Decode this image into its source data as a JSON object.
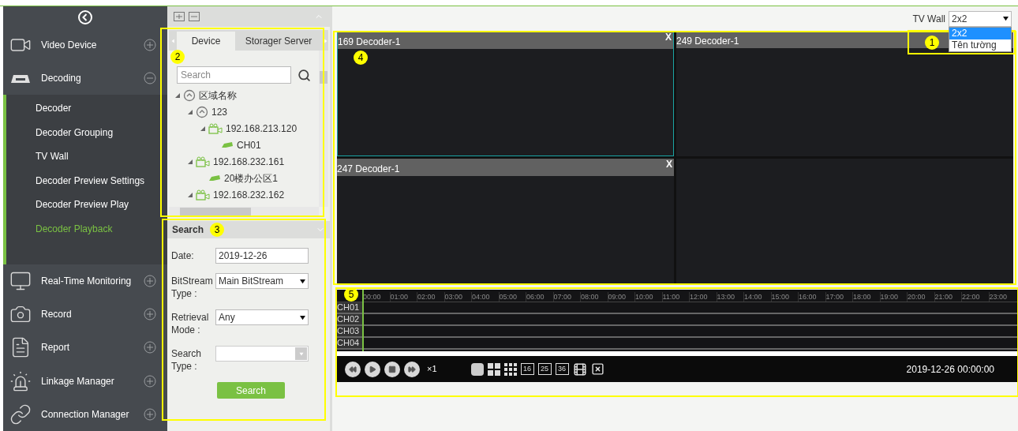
{
  "sidebar": {
    "items": [
      {
        "label": "Video Device",
        "expanded": false
      },
      {
        "label": "Decoding",
        "expanded": true,
        "children": [
          {
            "label": "Decoder",
            "selected": false
          },
          {
            "label": "Decoder Grouping",
            "selected": false
          },
          {
            "label": "TV Wall",
            "selected": false
          },
          {
            "label": "Decoder Preview Settings",
            "selected": false
          },
          {
            "label": "Decoder Preview Play",
            "selected": false
          },
          {
            "label": "Decoder Playback",
            "selected": true
          }
        ]
      },
      {
        "label": "Real-Time Monitoring",
        "expanded": false
      },
      {
        "label": "Record",
        "expanded": false
      },
      {
        "label": "Report",
        "expanded": false
      },
      {
        "label": "Linkage Manager",
        "expanded": false
      },
      {
        "label": "Connection Manager",
        "expanded": false
      }
    ]
  },
  "device_panel": {
    "tabs": [
      {
        "label": "Device",
        "selected": true
      },
      {
        "label": "Storager Server",
        "selected": false
      }
    ],
    "search": {
      "placeholder": "Search"
    },
    "tree": [
      {
        "label": "区域名称",
        "kind": "area",
        "expanded": true,
        "children": [
          {
            "label": "123",
            "kind": "area",
            "expanded": true,
            "children": [
              {
                "label": "192.168.213.120",
                "kind": "device",
                "expanded": true,
                "children": [
                  {
                    "label": "CH01",
                    "kind": "channel"
                  }
                ]
              }
            ]
          },
          {
            "label": "192.168.232.161",
            "kind": "device",
            "expanded": true,
            "children": [
              {
                "label": "20楼办公区1",
                "kind": "channel"
              }
            ]
          },
          {
            "label": "192.168.232.162",
            "kind": "device",
            "expanded": true
          }
        ]
      }
    ]
  },
  "search_panel": {
    "title": "Search",
    "fields": [
      {
        "label": "Date:",
        "kind": "text",
        "value": "2019-12-26"
      },
      {
        "label": "BitStream Type :",
        "kind": "select",
        "value": "Main BitStream"
      },
      {
        "label": "Retrieval Mode :",
        "kind": "select",
        "value": "Any"
      },
      {
        "label": "Search Type :",
        "kind": "combo"
      }
    ],
    "button": "Search"
  },
  "tv_wall": {
    "label": "TV Wall",
    "value": "2x2",
    "options": [
      {
        "label": "2x2",
        "selected": true
      },
      {
        "label": "Tên tường",
        "selected": false
      }
    ]
  },
  "screens": [
    {
      "title": "169 Decoder-1",
      "close": "X",
      "selected": true
    },
    {
      "title": "249 Decoder-1",
      "selected": false
    },
    {
      "title": "247 Decoder-1",
      "close": "X",
      "selected": false
    },
    {
      "selected": false
    }
  ],
  "timeline": {
    "hours": [
      "00:00",
      "01:00",
      "02:00",
      "03:00",
      "04:00",
      "05:00",
      "06:00",
      "07:00",
      "08:00",
      "09:00",
      "10:00",
      "11:00",
      "12:00",
      "13:00",
      "14:00",
      "15:00",
      "16:00",
      "17:00",
      "18:00",
      "19:00",
      "20:00",
      "21:00",
      "22:00",
      "23:00"
    ],
    "channels": [
      "CH01",
      "CH02",
      "CH03",
      "CH04"
    ],
    "speed": "×1",
    "layouts": [
      "16",
      "25",
      "36"
    ],
    "time": "2019-12-26 00:00:00"
  },
  "callouts": [
    "1",
    "2",
    "3",
    "4",
    "5"
  ]
}
